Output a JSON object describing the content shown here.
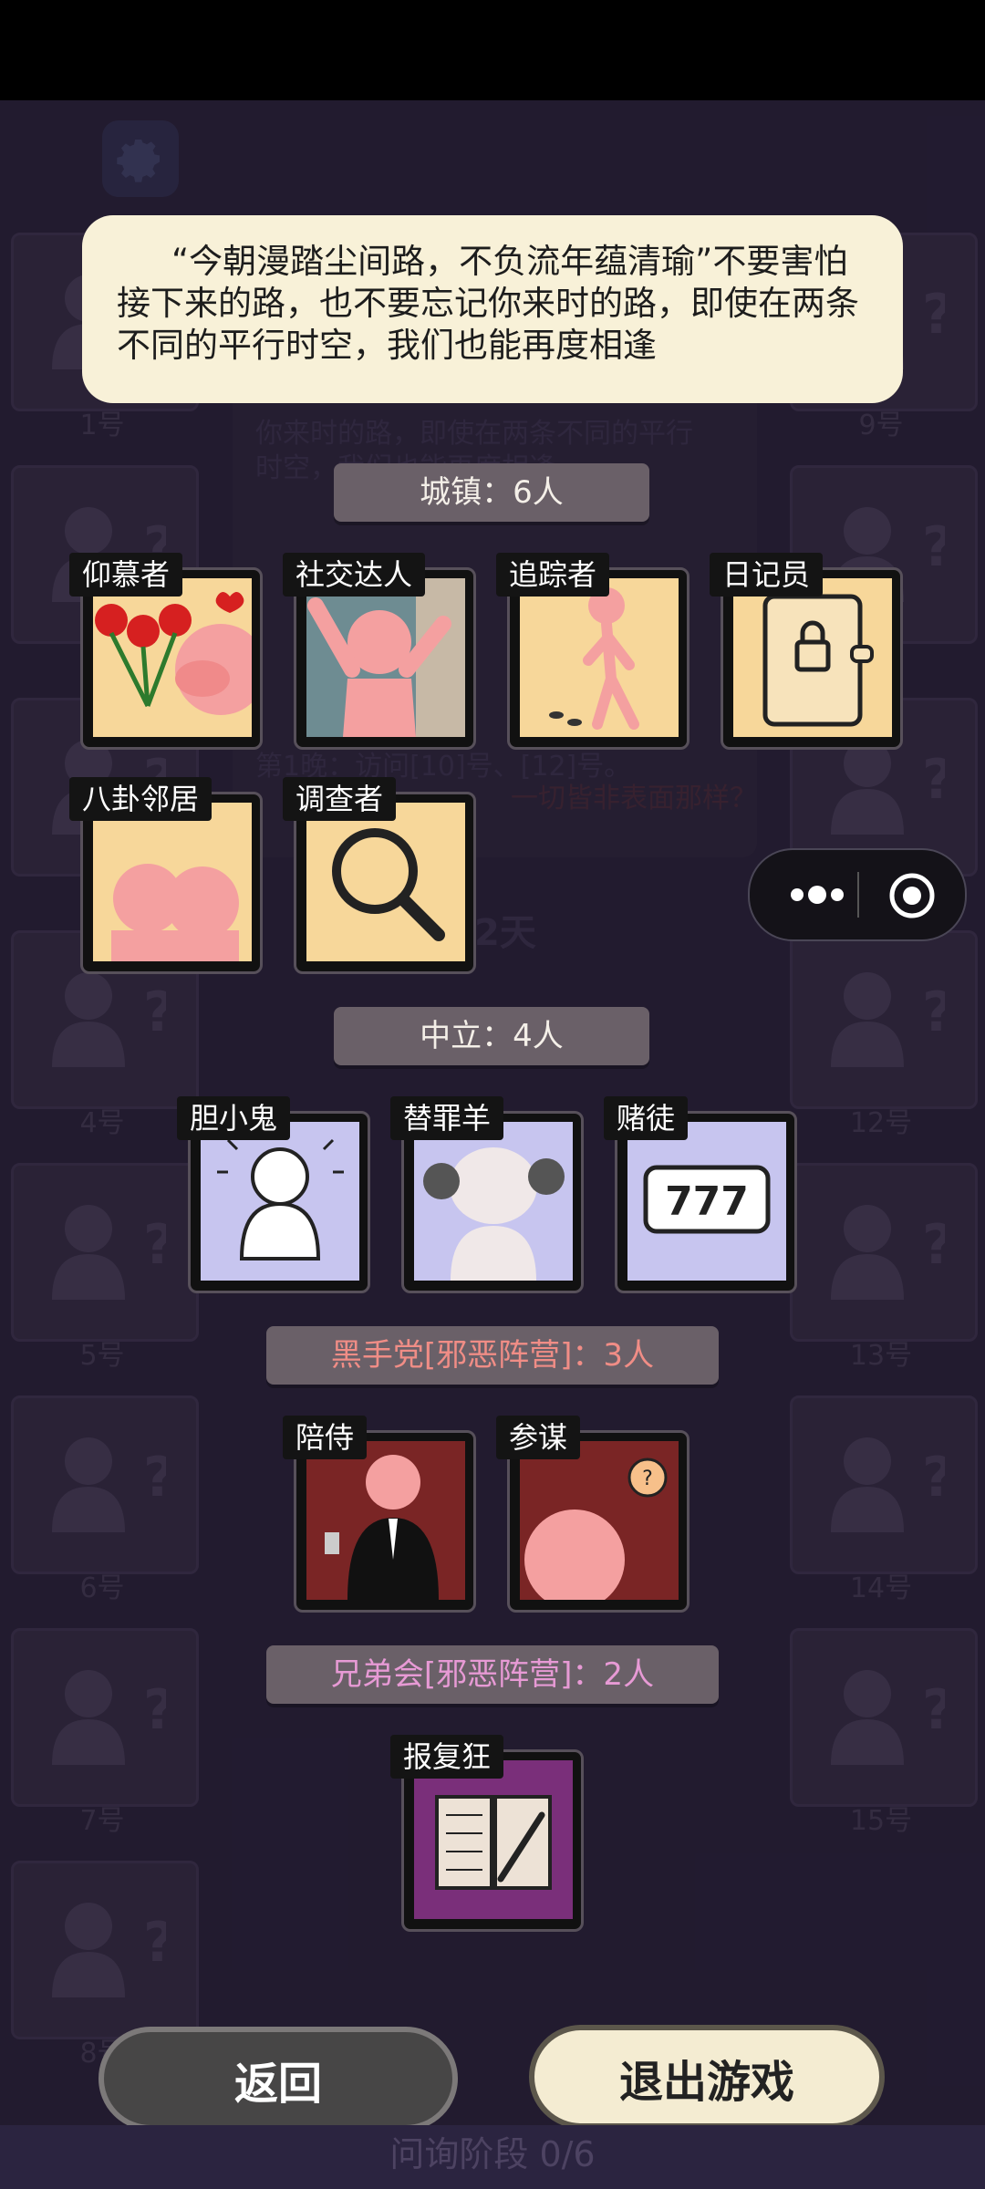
{
  "quote": "“今朝漫踏尘间路，不负流年蕴清瑜”不要害怕接下来的路，也不要忘记你来时的路，即使在两条不同的平行时空，我们也能再度相逢",
  "background": {
    "left_slots": [
      "1号",
      "",
      "",
      "4号",
      "5号",
      "6号",
      "7号",
      "8号"
    ],
    "right_slots": [
      "9号",
      "",
      "",
      "12号",
      "13号",
      "14号",
      "15号"
    ],
    "bg_lines": [
      "你来时的路，即使在两条不同的平行",
      "时空，我们也能再度相逢",
      "第1晚：访问[10]号、[12]号。",
      "一切皆非表面那样？",
      "2天"
    ]
  },
  "sections": {
    "town": {
      "header": "城镇：6人",
      "roles": [
        "仰慕者",
        "社交达人",
        "追踪者",
        "日记员",
        "八卦邻居",
        "调查者"
      ]
    },
    "neutral": {
      "header": "中立：4人",
      "roles": [
        "胆小鬼",
        "替罪羊",
        "赌徒"
      ]
    },
    "blackhand": {
      "header": "黑手党[邪恶阵营]：3人",
      "roles": [
        "陪侍",
        "参谋"
      ]
    },
    "brotherhood": {
      "header": "兄弟会[邪恶阵营]：2人",
      "roles": [
        "报复狂"
      ]
    }
  },
  "gambler_text": "777",
  "buttons": {
    "back": "返回",
    "exit": "退出游戏"
  },
  "phase": "问询阶段 0/6"
}
